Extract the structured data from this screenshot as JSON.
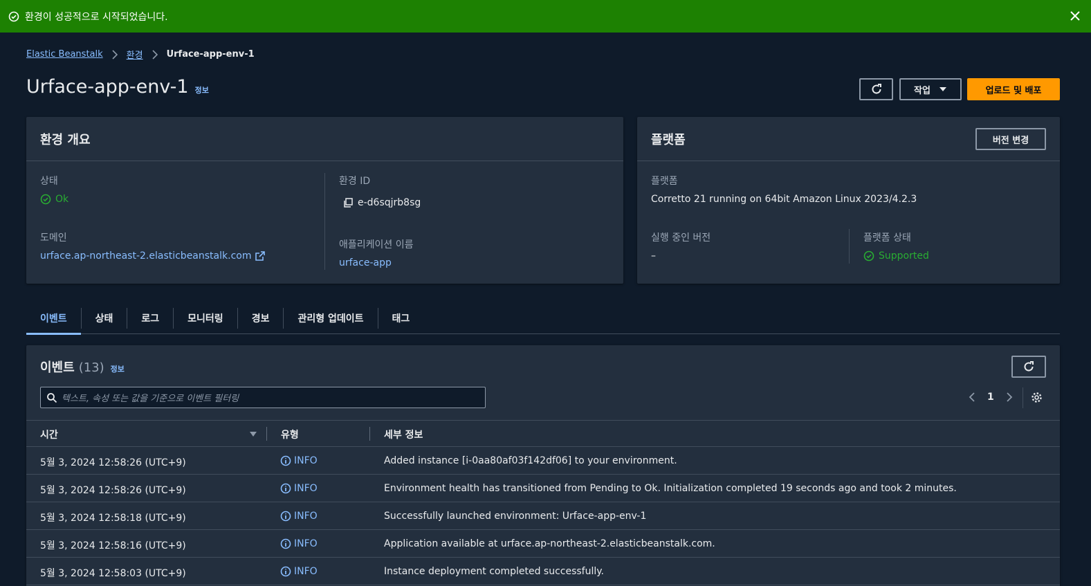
{
  "flash": {
    "message": "환경이 성공적으로 시작되었습니다."
  },
  "breadcrumb": {
    "root": "Elastic Beanstalk",
    "mid": "환경",
    "current": "Urface-app-env-1"
  },
  "header": {
    "title": "Urface-app-env-1",
    "info": "정보",
    "actions_label": "작업",
    "deploy_label": "업로드 및 배포"
  },
  "overview": {
    "title": "환경 개요",
    "status_label": "상태",
    "status_value": "Ok",
    "env_id_label": "환경 ID",
    "env_id_value": "e-d6sqjrb8sg",
    "domain_label": "도메인",
    "domain_value": "urface.ap-northeast-2.elasticbeanstalk.com",
    "app_name_label": "애플리케이션 이름",
    "app_name_value": "urface-app"
  },
  "platform": {
    "title": "플랫폼",
    "change_version_label": "버전 변경",
    "platform_label": "플랫폼",
    "platform_value": "Corretto 21 running on 64bit Amazon Linux 2023/4.2.3",
    "running_version_label": "실행 중인 버전",
    "running_version_value": "–",
    "platform_state_label": "플랫폼 상태",
    "platform_state_value": "Supported"
  },
  "tabs": [
    {
      "label": "이벤트",
      "active": true
    },
    {
      "label": "상태"
    },
    {
      "label": "로그"
    },
    {
      "label": "모니터링"
    },
    {
      "label": "경보"
    },
    {
      "label": "관리형 업데이트"
    },
    {
      "label": "태그"
    }
  ],
  "events": {
    "title": "이벤트",
    "count": "(13)",
    "info": "정보",
    "search_placeholder": "텍스트, 속성 또는 값을 기준으로 이벤트 필터링",
    "page": "1",
    "columns": {
      "time": "시간",
      "type": "유형",
      "details": "세부 정보"
    },
    "rows": [
      {
        "time": "5월 3, 2024 12:58:26 (UTC+9)",
        "type": "INFO",
        "details": "Added instance [i-0aa80af03f142df06] to your environment."
      },
      {
        "time": "5월 3, 2024 12:58:26 (UTC+9)",
        "type": "INFO",
        "details": "Environment health has transitioned from Pending to Ok. Initialization completed 19 seconds ago and took 2 minutes."
      },
      {
        "time": "5월 3, 2024 12:58:18 (UTC+9)",
        "type": "INFO",
        "details": "Successfully launched environment: Urface-app-env-1"
      },
      {
        "time": "5월 3, 2024 12:58:16 (UTC+9)",
        "type": "INFO",
        "details": "Application available at urface.ap-northeast-2.elasticbeanstalk.com."
      },
      {
        "time": "5월 3, 2024 12:58:03 (UTC+9)",
        "type": "INFO",
        "details": "Instance deployment completed successfully."
      }
    ]
  },
  "colors": {
    "success": "#1d8102",
    "primary": "#ff9900",
    "link": "#89bdff",
    "ok": "#29ad32"
  }
}
